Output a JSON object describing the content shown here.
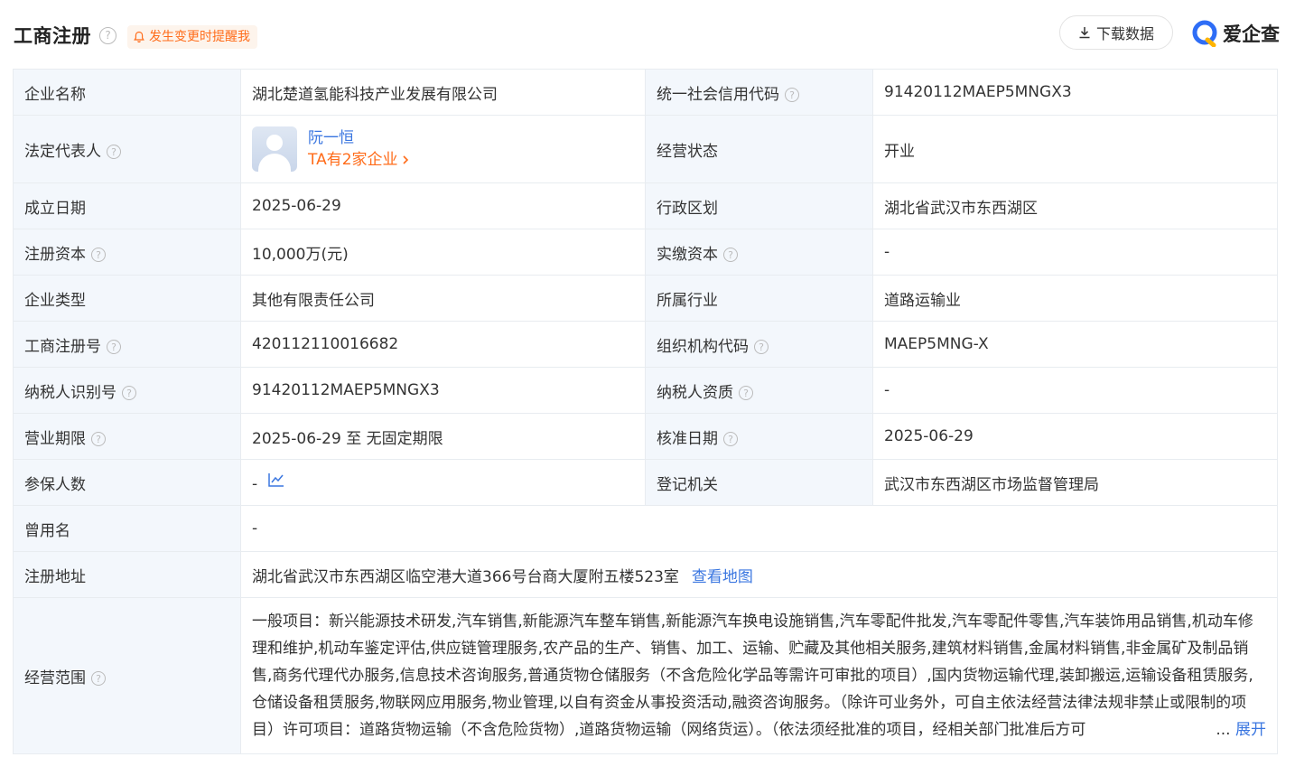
{
  "header": {
    "title": "工商注册",
    "remind_label": "发生变更时提醒我",
    "download_label": "下载数据",
    "logo_text": "爱企查"
  },
  "rows": {
    "company_name": {
      "label": "企业名称",
      "value": "湖北楚道氢能科技产业发展有限公司"
    },
    "credit_code": {
      "label": "统一社会信用代码",
      "value": "91420112MAEP5MNGX3"
    },
    "legal_rep": {
      "label": "法定代表人",
      "name": "阮一恒",
      "companies": "TA有2家企业"
    },
    "status": {
      "label": "经营状态",
      "value": "开业"
    },
    "founded": {
      "label": "成立日期",
      "value": "2025-06-29"
    },
    "region": {
      "label": "行政区划",
      "value": "湖北省武汉市东西湖区"
    },
    "reg_capital": {
      "label": "注册资本",
      "value": "10,000万(元)"
    },
    "paid_capital": {
      "label": "实缴资本",
      "value": "-"
    },
    "company_type": {
      "label": "企业类型",
      "value": "其他有限责任公司"
    },
    "industry": {
      "label": "所属行业",
      "value": "道路运输业"
    },
    "reg_no": {
      "label": "工商注册号",
      "value": "420112110016682"
    },
    "org_code": {
      "label": "组织机构代码",
      "value": "MAEP5MNG-X"
    },
    "taxpayer_id": {
      "label": "纳税人识别号",
      "value": "91420112MAEP5MNGX3"
    },
    "taxpayer_qual": {
      "label": "纳税人资质",
      "value": "-"
    },
    "term": {
      "label": "营业期限",
      "value": "2025-06-29 至 无固定期限"
    },
    "approve_date": {
      "label": "核准日期",
      "value": "2025-06-29"
    },
    "insured": {
      "label": "参保人数",
      "value": "-"
    },
    "authority": {
      "label": "登记机关",
      "value": "武汉市东西湖区市场监督管理局"
    },
    "former_name": {
      "label": "曾用名",
      "value": "-"
    },
    "address": {
      "label": "注册地址",
      "value": "湖北省武汉市东西湖区临空港大道366号台商大厦附五楼523室",
      "map_link": "查看地图"
    },
    "scope": {
      "label": "经营范围",
      "value": "一般项目：新兴能源技术研发,汽车销售,新能源汽车整车销售,新能源汽车换电设施销售,汽车零配件批发,汽车零配件零售,汽车装饰用品销售,机动车修理和维护,机动车鉴定评估,供应链管理服务,农产品的生产、销售、加工、运输、贮藏及其他相关服务,建筑材料销售,金属材料销售,非金属矿及制品销售,商务代理代办服务,信息技术咨询服务,普通货物仓储服务（不含危险化学品等需许可审批的项目）,国内货物运输代理,装卸搬运,运输设备租赁服务,仓储设备租赁服务,物联网应用服务,物业管理,以自有资金从事投资活动,融资咨询服务。（除许可业务外，可自主依法经营法律法规非禁止或限制的项目）许可项目：道路货物运输（不含危险货物）,道路货物运输（网络货运）。（依法须经批准的项目，经相关部门批准后方可",
      "ellipsis": "...",
      "expand_label": "展开"
    }
  },
  "colors": {
    "accent": "#3a76e0",
    "orange": "#ff6c1a",
    "label_bg": "#f3f7fc",
    "border": "#e8ecf0"
  },
  "icons": {
    "help": "?",
    "bell": "bell-icon",
    "download": "download-icon",
    "chart": "trend-chart-icon"
  }
}
